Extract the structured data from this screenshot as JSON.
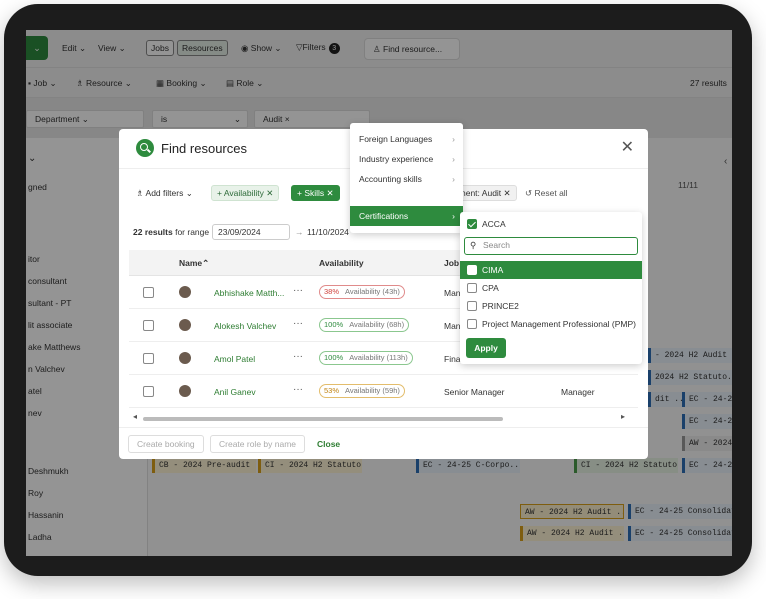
{
  "toolbar": {
    "edit": "Edit",
    "view": "View",
    "jobs": "Jobs",
    "resources": "Resources",
    "show": "Show",
    "filters": "Filters",
    "filters_count": "3",
    "find_resource": "Find resource..."
  },
  "subbar": {
    "job": "Job",
    "resource": "Resource",
    "booking": "Booking",
    "role": "Role",
    "results": "27 results"
  },
  "filterbar": {
    "department": "Department",
    "operator": "is",
    "value": "Audit"
  },
  "left_rows": [
    "gned",
    "itor",
    "consultant",
    "sultant - PT",
    "lit associate",
    "ake Matthews",
    "n Valchev",
    "atel",
    "nev",
    "Deshmukh",
    "Roy",
    "Hassanin",
    "Ladha"
  ],
  "grid": {
    "date_label": "11/11",
    "bars": [
      "- 2024 H2 Audit ...",
      "2024 H2 Statuto...",
      "dit ...",
      "EC - 24-25",
      "EC - 24-25",
      "AW - 2024",
      "CB - 2024 Pre-audit ...",
      "CI - 2024 H2 Statuto...",
      "EC - 24-25 C-Corpo...",
      "CI - 2024 H2 Statuto...",
      "EC - 24-25",
      "AW - 2024 H2 Audit ...",
      "EC - 24-25 Consolidated",
      "AW - 2024 H2 Audit ...",
      "EC - 24-25 Consolidated"
    ]
  },
  "modal": {
    "title": "Find resources",
    "add_filters": "Add filters",
    "chip_availability": "Availability",
    "chip_skills": "Skills",
    "chip_department": "nent: Audit",
    "reset_all": "Reset all",
    "results_count": "22 results",
    "results_suffix": "for range",
    "date_from": "23/09/2024",
    "date_sep": "→",
    "date_to": "11/10/2024",
    "columns": {
      "name": "Name",
      "availability": "Availability",
      "job": "Job"
    },
    "rows": [
      {
        "name": "Abhishake Matth...",
        "pct": "38%",
        "avail": "Availability (43h)",
        "job": "Man",
        "role": ""
      },
      {
        "name": "Alokesh Valchev",
        "pct": "100%",
        "avail": "Availability (68h)",
        "job": "Man",
        "role": ""
      },
      {
        "name": "Amol Patel",
        "pct": "100%",
        "avail": "Availability (113h)",
        "job": "Fina",
        "role": ""
      },
      {
        "name": "Anil Ganev",
        "pct": "53%",
        "avail": "Availability (59h)",
        "job": "Senior Manager",
        "role": "Manager"
      }
    ],
    "create_booking": "Create booking",
    "create_role": "Create role by name",
    "close": "Close"
  },
  "skills_menu": {
    "items": [
      "Foreign Languages",
      "Industry experience",
      "Accounting skills",
      "Certifications"
    ]
  },
  "cert_menu": {
    "acca": "ACCA",
    "search_placeholder": "Search",
    "options": [
      "CIMA",
      "CPA",
      "PRINCE2",
      "Project Management Professional (PMP)"
    ],
    "apply": "Apply"
  }
}
